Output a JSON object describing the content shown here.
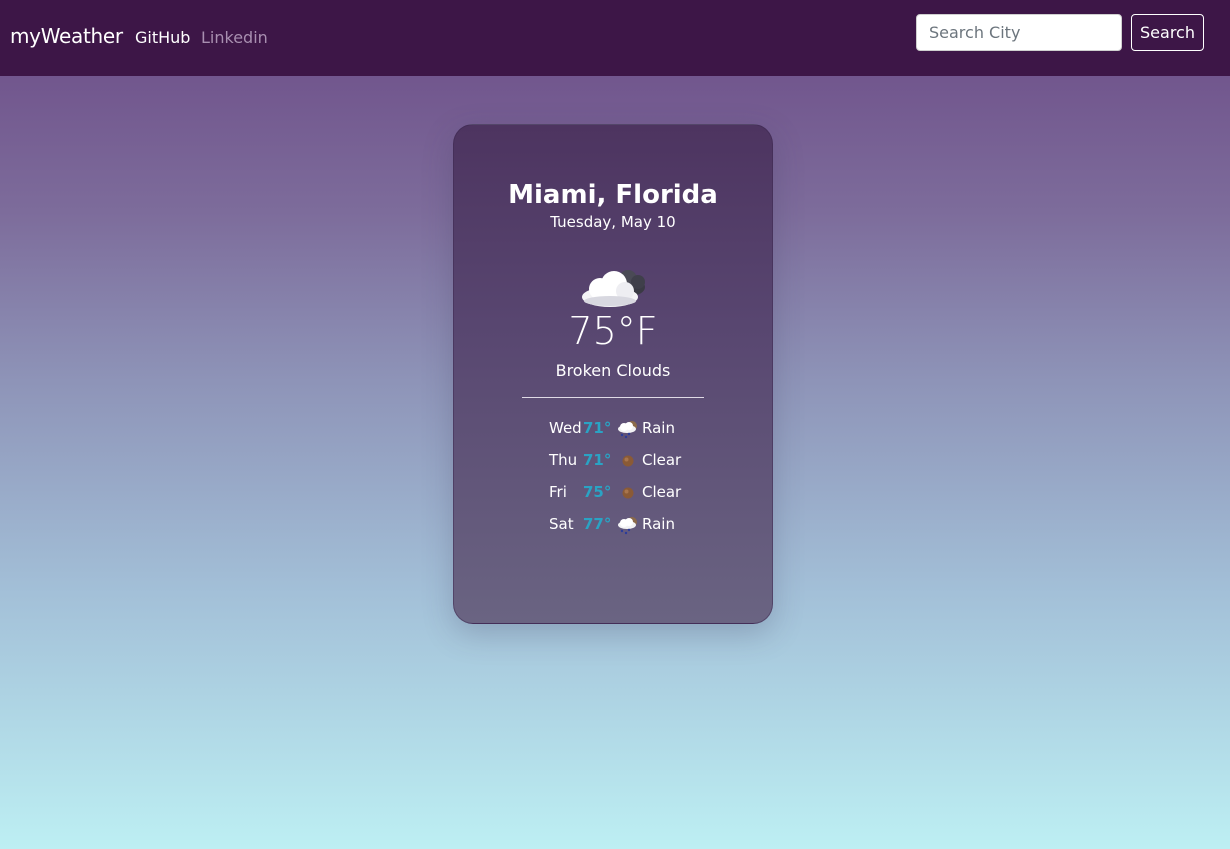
{
  "app": {
    "brand": "myWeather"
  },
  "nav": {
    "links": [
      "GitHub",
      "Linkedin"
    ]
  },
  "search": {
    "placeholder": "Search City",
    "value": "",
    "button_label": "Search"
  },
  "current": {
    "city": "Miami, Florida",
    "date": "Tuesday, May 10",
    "icon": "broken-clouds-icon",
    "temperature": "75°F",
    "description": "Broken Clouds"
  },
  "forecast": [
    {
      "day": "Wed",
      "temp": "71°",
      "icon": "rain-icon",
      "condition": "Rain"
    },
    {
      "day": "Thu",
      "temp": "71°",
      "icon": "clear-icon",
      "condition": "Clear"
    },
    {
      "day": "Fri",
      "temp": "75°",
      "icon": "clear-icon",
      "condition": "Clear"
    },
    {
      "day": "Sat",
      "temp": "77°",
      "icon": "rain-icon",
      "condition": "Rain"
    }
  ],
  "colors": {
    "navbar": "#3d1647",
    "forecast_temp": "#2aa3c4",
    "inactive_link": "#a88fb0"
  }
}
